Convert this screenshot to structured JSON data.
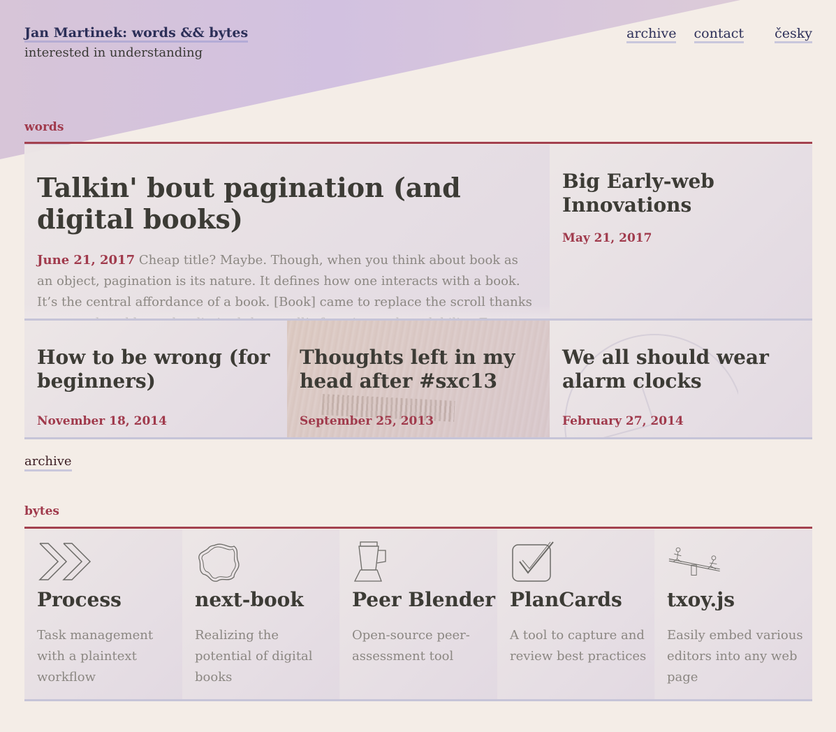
{
  "header": {
    "site_title": "Jan Martinek: words && bytes",
    "tagline": "interested in understanding"
  },
  "nav": {
    "archive": "archive",
    "contact": "contact",
    "language": "česky"
  },
  "words": {
    "label": "words",
    "featured": {
      "title": "Talkin' bout pagination (and digital books)",
      "date": "June 21, 2017",
      "excerpt": "Cheap title? Maybe. Though, when you think about book as an object, pagination is its nature. It defines how one interacts with a book. It’s the central affordance of a book. [Book] came to replace the scroll thanks to several problems that limited the scroll’s function and readability. For one"
    },
    "side": {
      "title": "Big Early-web Innovations",
      "date": "May 21, 2017"
    },
    "posts": [
      {
        "title": "How to be wrong (for beginners)",
        "date": "November 18, 2014"
      },
      {
        "title": "Thoughts left in my head after #sxc13",
        "date": "September 25, 2013"
      },
      {
        "title": "We all should wear alarm clocks",
        "date": "February 27, 2014"
      }
    ],
    "archive_link": "archive"
  },
  "bytes": {
    "label": "bytes",
    "items": [
      {
        "title": "Process",
        "desc": "Task management with a plaintext workflow",
        "icon": "double-chevron-icon"
      },
      {
        "title": "next-book",
        "desc": "Realizing the potential of digital books",
        "icon": "scribble-blob-icon"
      },
      {
        "title": "Peer Blender",
        "desc": "Open-source peer-assessment tool",
        "icon": "blender-icon"
      },
      {
        "title": "PlanCards",
        "desc": "A tool to capture and review best practices",
        "icon": "checkmark-card-icon"
      },
      {
        "title": "txoy.js",
        "desc": "Easily embed various editors into any web page",
        "icon": "seesaw-icon"
      }
    ]
  },
  "colors": {
    "accent": "#a03a4c",
    "link": "#2c2f58",
    "background": "#f4ede7",
    "wedge": "#d3c2dd"
  }
}
